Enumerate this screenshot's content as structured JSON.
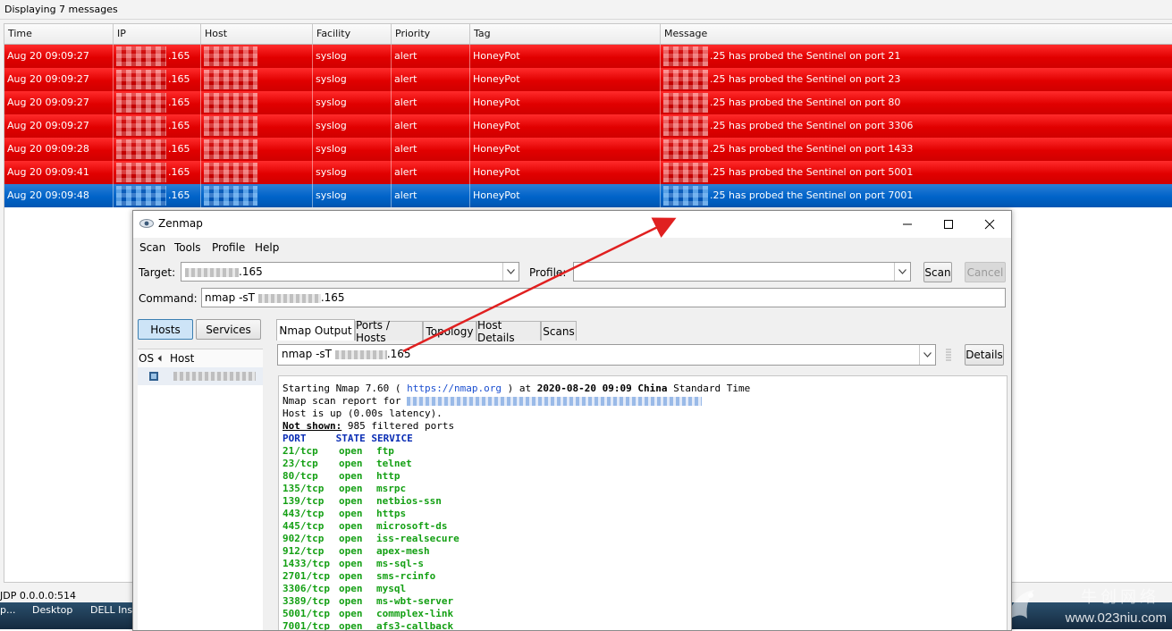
{
  "syslog": {
    "status": "Displaying 7 messages",
    "columns": [
      "Time",
      "IP",
      "Host",
      "Facility",
      "Priority",
      "Tag",
      "Message"
    ],
    "rows": [
      {
        "time": "Aug 20 09:09:27",
        "ip_suffix": ".165",
        "facility": "syslog",
        "priority": "alert",
        "tag": "HoneyPot",
        "message": ".25 has probed the Sentinel  on port 21",
        "selected": false
      },
      {
        "time": "Aug 20 09:09:27",
        "ip_suffix": ".165",
        "facility": "syslog",
        "priority": "alert",
        "tag": "HoneyPot",
        "message": ".25 has probed the Sentinel  on port 23",
        "selected": false
      },
      {
        "time": "Aug 20 09:09:27",
        "ip_suffix": ".165",
        "facility": "syslog",
        "priority": "alert",
        "tag": "HoneyPot",
        "message": ".25 has probed the Sentinel  on port 80",
        "selected": false
      },
      {
        "time": "Aug 20 09:09:27",
        "ip_suffix": ".165",
        "facility": "syslog",
        "priority": "alert",
        "tag": "HoneyPot",
        "message": ".25 has probed the Sentinel  on port 3306",
        "selected": false
      },
      {
        "time": "Aug 20 09:09:28",
        "ip_suffix": ".165",
        "facility": "syslog",
        "priority": "alert",
        "tag": "HoneyPot",
        "message": ".25 has probed the Sentinel  on port 1433",
        "selected": false
      },
      {
        "time": "Aug 20 09:09:41",
        "ip_suffix": ".165",
        "facility": "syslog",
        "priority": "alert",
        "tag": "HoneyPot",
        "message": ".25 has probed the Sentinel  on port 5001",
        "selected": false
      },
      {
        "time": "Aug 20 09:09:48",
        "ip_suffix": ".165",
        "facility": "syslog",
        "priority": "alert",
        "tag": "HoneyPot",
        "message": ".25 has probed the Sentinel  on port 7001",
        "selected": true
      }
    ],
    "bottom_status": "JDP 0.0.0.0:514",
    "taskbar": [
      "p...",
      "Desktop",
      "DELL Inst"
    ],
    "colors": {
      "alert_row": "#e10000",
      "selected_row": "#0063c8"
    }
  },
  "watermark": {
    "text": "www.023niu.com",
    "cjk": "牛创网络"
  },
  "zenmap": {
    "title": "Zenmap",
    "menu": [
      "Scan",
      "Tools",
      "Profile",
      "Help"
    ],
    "target_label": "Target:",
    "target_value": ".165",
    "profile_label": "Profile:",
    "profile_value": "",
    "scan_button": "Scan",
    "cancel_button": "Cancel",
    "command_label": "Command:",
    "command_value_prefix": "nmap -sT ",
    "command_value_suffix": ".165",
    "hosts_button": "Hosts",
    "services_button": "Services",
    "host_columns": [
      "OS",
      "Host"
    ],
    "tabs": [
      "Nmap Output",
      "Ports / Hosts",
      "Topology",
      "Host Details",
      "Scans"
    ],
    "active_tab": "Nmap Output",
    "output_combo_prefix": "nmap -sT ",
    "output_combo_suffix": ".165",
    "details_button": "Details",
    "output": {
      "line1_pre": "Starting Nmap 7.60 ( ",
      "line1_url": "https://nmap.org",
      "line1_mid": " ) at ",
      "line1_time": "2020-08-20 09:09",
      "line1_tz": " China",
      "line1_end": " Standard Time",
      "line2": "Nmap scan report for ",
      "line3": "Host is up (0.00s latency).",
      "line4_label": "Not shown:",
      "line4_rest": " 985 filtered ports",
      "header": "PORT     STATE SERVICE",
      "ports": [
        {
          "port": "21/tcp",
          "state": "open",
          "service": "ftp"
        },
        {
          "port": "23/tcp",
          "state": "open",
          "service": "telnet"
        },
        {
          "port": "80/tcp",
          "state": "open",
          "service": "http"
        },
        {
          "port": "135/tcp",
          "state": "open",
          "service": "msrpc"
        },
        {
          "port": "139/tcp",
          "state": "open",
          "service": "netbios-ssn"
        },
        {
          "port": "443/tcp",
          "state": "open",
          "service": "https"
        },
        {
          "port": "445/tcp",
          "state": "open",
          "service": "microsoft-ds"
        },
        {
          "port": "902/tcp",
          "state": "open",
          "service": "iss-realsecure"
        },
        {
          "port": "912/tcp",
          "state": "open",
          "service": "apex-mesh"
        },
        {
          "port": "1433/tcp",
          "state": "open",
          "service": "ms-sql-s"
        },
        {
          "port": "2701/tcp",
          "state": "open",
          "service": "sms-rcinfo"
        },
        {
          "port": "3306/tcp",
          "state": "open",
          "service": "mysql"
        },
        {
          "port": "3389/tcp",
          "state": "open",
          "service": "ms-wbt-server"
        },
        {
          "port": "5001/tcp",
          "state": "open",
          "service": "commplex-link"
        },
        {
          "port": "7001/tcp",
          "state": "open",
          "service": "afs3-callback"
        }
      ]
    }
  },
  "annotation": {
    "arrow_color": "#e02020"
  }
}
